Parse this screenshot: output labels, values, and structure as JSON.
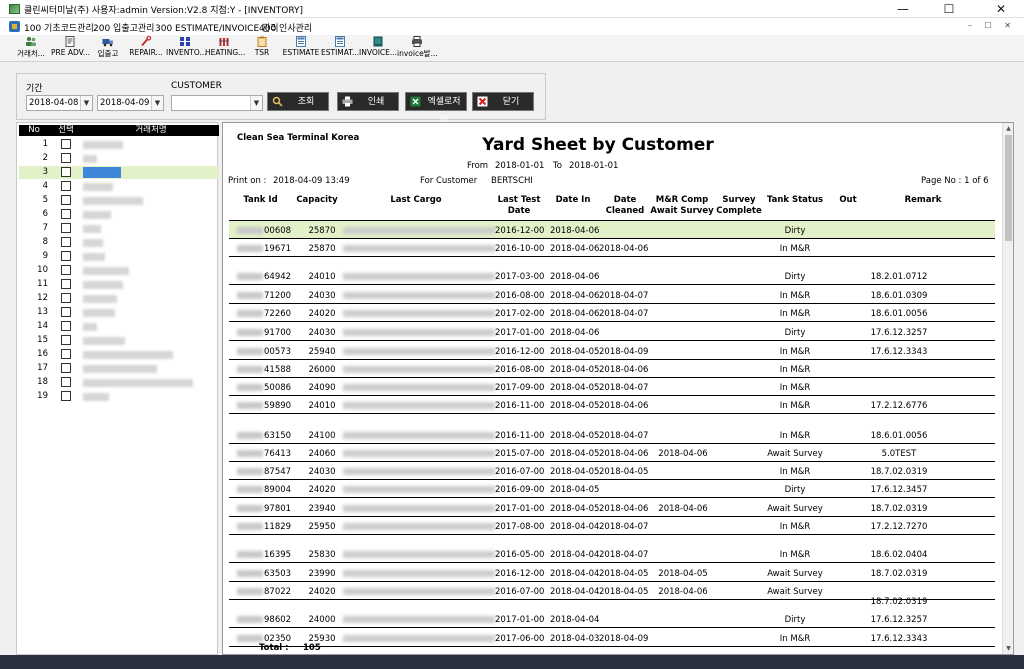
{
  "window": {
    "title": "클린씨터미날(주) 사용자:admin Version:V2.8 지점:Y - [INVENTORY]",
    "minimize": "—",
    "maximize": "☐",
    "close": "✕"
  },
  "menu": {
    "items": [
      "100 기초코드관리",
      "200 입출고관리",
      "300 ESTIMATE/INVOICE 관리",
      "400 인사관리"
    ],
    "mdi_controls": "– ☐ ✕"
  },
  "toolbar": {
    "items": [
      {
        "label": "거래처...",
        "icon": "people-icon",
        "color": "#3a7a3a"
      },
      {
        "label": "PRE ADV...",
        "icon": "document-icon",
        "color": "#555555"
      },
      {
        "label": "입출고",
        "icon": "truck-icon",
        "color": "#2d5aa0"
      },
      {
        "label": "REPAIR...",
        "icon": "wrench-icon",
        "color": "#c03030"
      },
      {
        "label": "INVENTO...",
        "icon": "grid-icon",
        "color": "#2f3fb0"
      },
      {
        "label": "HEATING...",
        "icon": "heater-icon",
        "color": "#b03030"
      },
      {
        "label": "TSR",
        "icon": "clipboard-icon",
        "color": "#c07a20"
      },
      {
        "label": "ESTIMATE",
        "icon": "form-icon",
        "color": "#4a7ab0"
      },
      {
        "label": "ESTIMAT...",
        "icon": "form-icon",
        "color": "#4a7ab0"
      },
      {
        "label": "INVOICE...",
        "icon": "invoice-icon",
        "color": "#1a5a5a"
      },
      {
        "label": "invoice발...",
        "icon": "printer-icon",
        "color": "#333333"
      }
    ]
  },
  "filter": {
    "period_label": "기간",
    "date_from": "2018-04-08",
    "date_to": "2018-04-09",
    "customer_label": "CUSTOMER",
    "customer_value": "",
    "buttons": {
      "search": "조회",
      "print": "인쇄",
      "excel": "엑셀로저장",
      "close": "닫기"
    }
  },
  "left_grid": {
    "headers": [
      "No",
      "선택",
      "거래처명"
    ],
    "rows": [
      "1",
      "2",
      "3",
      "4",
      "5",
      "6",
      "7",
      "8",
      "9",
      "10",
      "11",
      "12",
      "13",
      "14",
      "15",
      "16",
      "17",
      "18",
      "19"
    ],
    "selected_index": 2
  },
  "report": {
    "company": "Clean Sea Terminal Korea",
    "title": "Yard Sheet by Customer",
    "from_label": "From",
    "from_date": "2018-01-01",
    "to_label": "To",
    "to_date": "2018-01-01",
    "print_on_label": "Print on :",
    "print_on": "2018-04-09 13:49",
    "for_customer_label": "For Customer",
    "for_customer": "BERTSCHI",
    "page": "Page No : 1 of 6",
    "columns": {
      "tank_id": "Tank Id",
      "capacity": "Capacity",
      "last_cargo": "Last Cargo",
      "last_test_date": "Last Test Date",
      "date_in": "Date In",
      "date_cleaned": "Date Cleaned",
      "mr_comp": "M&R Comp Await Survey",
      "survey_complete": "Survey Complete",
      "tank_status": "Tank Status",
      "out": "Out",
      "remark": "Remark"
    },
    "rows": [
      {
        "tank": "00608",
        "cap": "25870",
        "test": "2016-12-00",
        "din": "2018-04-06",
        "dcl": "",
        "mr": "",
        "status": "Dirty",
        "remark": ""
      },
      {
        "tank": "19671",
        "cap": "25870",
        "test": "2016-10-00",
        "din": "2018-04-06",
        "dcl": "2018-04-06",
        "mr": "",
        "status": "In M&R",
        "remark": ""
      },
      {
        "tank": "64942",
        "cap": "24010",
        "test": "2017-03-00",
        "din": "2018-04-06",
        "dcl": "",
        "mr": "",
        "status": "Dirty",
        "remark": "18.2.01.0712"
      },
      {
        "tank": "71200",
        "cap": "24030",
        "test": "2016-08-00",
        "din": "2018-04-06",
        "dcl": "2018-04-07",
        "mr": "",
        "status": "In M&R",
        "remark": "18.6.01.0309"
      },
      {
        "tank": "72260",
        "cap": "24020",
        "test": "2017-02-00",
        "din": "2018-04-06",
        "dcl": "2018-04-07",
        "mr": "",
        "status": "In M&R",
        "remark": "18.6.01.0056"
      },
      {
        "tank": "91700",
        "cap": "24030",
        "test": "2017-01-00",
        "din": "2018-04-06",
        "dcl": "",
        "mr": "",
        "status": "Dirty",
        "remark": "17.6.12.3257"
      },
      {
        "tank": "00573",
        "cap": "25940",
        "test": "2016-12-00",
        "din": "2018-04-05",
        "dcl": "2018-04-09",
        "mr": "",
        "status": "In M&R",
        "remark": "17.6.12.3343"
      },
      {
        "tank": "41588",
        "cap": "26000",
        "test": "2016-08-00",
        "din": "2018-04-05",
        "dcl": "2018-04-06",
        "mr": "",
        "status": "In M&R",
        "remark": ""
      },
      {
        "tank": "50086",
        "cap": "24090",
        "test": "2017-09-00",
        "din": "2018-04-05",
        "dcl": "2018-04-07",
        "mr": "",
        "status": "In M&R",
        "remark": ""
      },
      {
        "tank": "59890",
        "cap": "24010",
        "test": "2016-11-00",
        "din": "2018-04-05",
        "dcl": "2018-04-06",
        "mr": "",
        "status": "In M&R",
        "remark": "17.2.12.6776"
      },
      {
        "tank": "63150",
        "cap": "24100",
        "test": "2016-11-00",
        "din": "2018-04-05",
        "dcl": "2018-04-07",
        "mr": "",
        "status": "In M&R",
        "remark": "18.6.01.0056"
      },
      {
        "tank": "76413",
        "cap": "24060",
        "test": "2015-07-00",
        "din": "2018-04-05",
        "dcl": "2018-04-06",
        "mr": "2018-04-06",
        "status": "Await Survey",
        "remark": "5.0TEST"
      },
      {
        "tank": "87547",
        "cap": "24030",
        "test": "2016-07-00",
        "din": "2018-04-05",
        "dcl": "2018-04-05",
        "mr": "",
        "status": "In M&R",
        "remark": "18.7.02.0319"
      },
      {
        "tank": "89004",
        "cap": "24020",
        "test": "2016-09-00",
        "din": "2018-04-05",
        "dcl": "",
        "mr": "",
        "status": "Dirty",
        "remark": "17.6.12.3457"
      },
      {
        "tank": "97801",
        "cap": "23940",
        "test": "2017-01-00",
        "din": "2018-04-05",
        "dcl": "2018-04-06",
        "mr": "2018-04-06",
        "status": "Await Survey",
        "remark": "18.7.02.0319"
      },
      {
        "tank": "11829",
        "cap": "25950",
        "test": "2017-08-00",
        "din": "2018-04-04",
        "dcl": "2018-04-07",
        "mr": "",
        "status": "In M&R",
        "remark": "17.2.12.7270"
      },
      {
        "tank": "16395",
        "cap": "25830",
        "test": "2016-05-00",
        "din": "2018-04-04",
        "dcl": "2018-04-07",
        "mr": "",
        "status": "In M&R",
        "remark": "18.6.02.0404"
      },
      {
        "tank": "63503",
        "cap": "23990",
        "test": "2016-12-00",
        "din": "2018-04-04",
        "dcl": "2018-04-05",
        "mr": "2018-04-05",
        "status": "Await Survey",
        "remark": "18.7.02.0319"
      },
      {
        "tank": "87022",
        "cap": "24020",
        "test": "2016-07-00",
        "din": "2018-04-04",
        "dcl": "2018-04-05",
        "mr": "2018-04-06",
        "status": "Await Survey",
        "remark": "18.7.02.0319"
      },
      {
        "tank": "98602",
        "cap": "24000",
        "test": "2017-01-00",
        "din": "2018-04-04",
        "dcl": "",
        "mr": "",
        "status": "Dirty",
        "remark": "17.6.12.3257"
      },
      {
        "tank": "02350",
        "cap": "25930",
        "test": "2017-06-00",
        "din": "2018-04-03",
        "dcl": "2018-04-09",
        "mr": "",
        "status": "In M&R",
        "remark": "17.6.12.3343"
      }
    ],
    "total_label": "Total :",
    "total_value": "105"
  }
}
